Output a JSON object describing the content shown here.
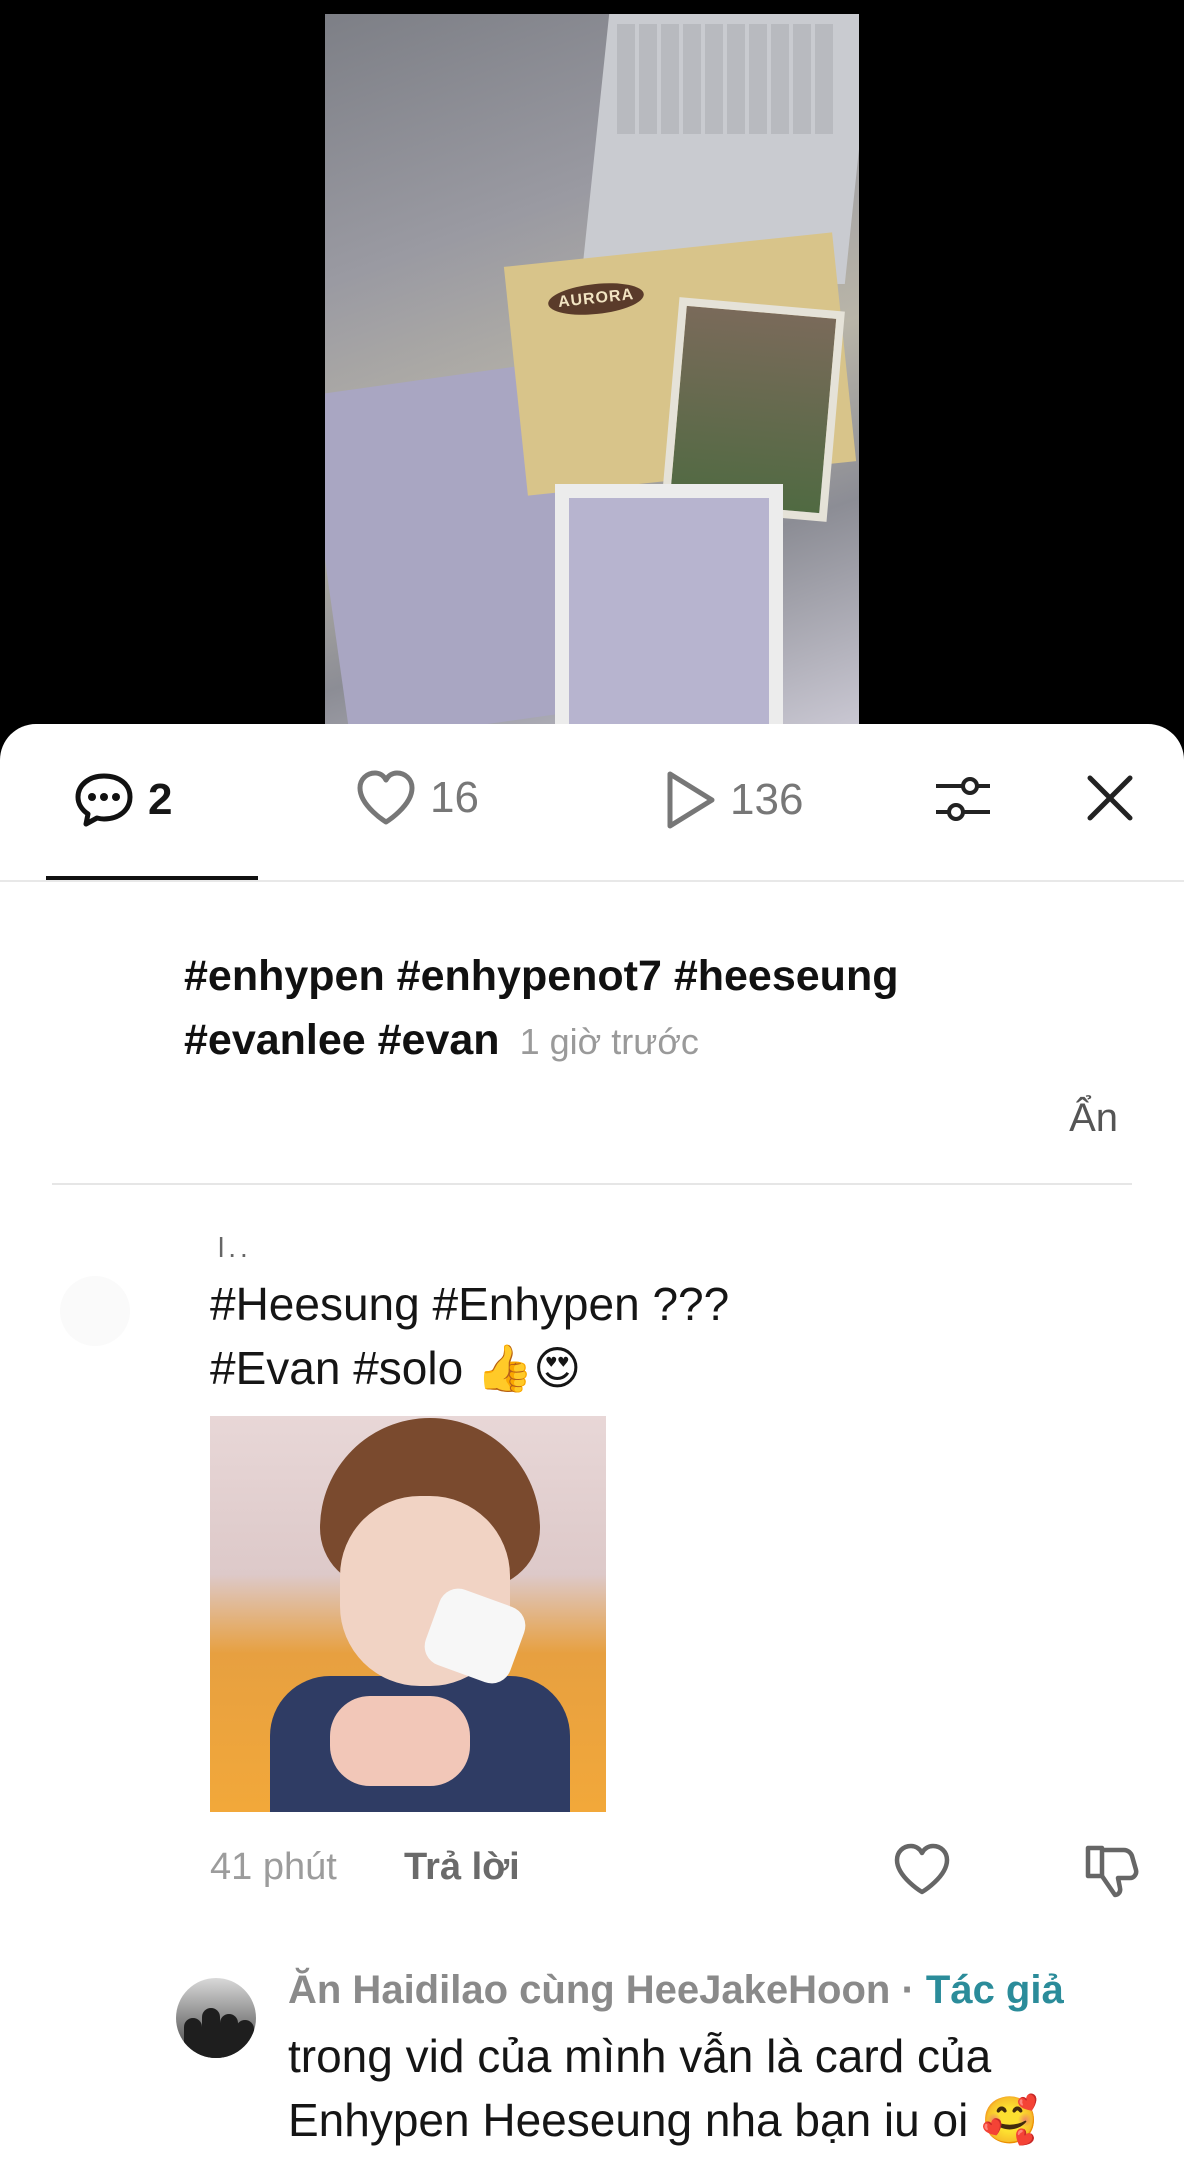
{
  "stats": {
    "comments": "2",
    "likes": "16",
    "views": "136"
  },
  "caption": {
    "line1": "#enhypen #enhypenot7  #heeseung",
    "line2": "#evanlee #evan",
    "time": "1 giờ trước"
  },
  "hide_label": "Ẩn",
  "comment": {
    "username": "l..",
    "text_line1": "#Heesung #Enhypen ???",
    "text_line2": "#Evan #solo 👍😍",
    "time": "41 phút",
    "reply_label": "Trả lời"
  },
  "reply": {
    "username": "Ăn Haidilao cùng HeeJakeHoon",
    "separator": " · ",
    "badge": "Tác giả",
    "text": "trong vid của mình vẫn là card của Enhypen Heeseung nha bạn iu oi 🥰"
  },
  "video_sticker_text": "AURORA"
}
